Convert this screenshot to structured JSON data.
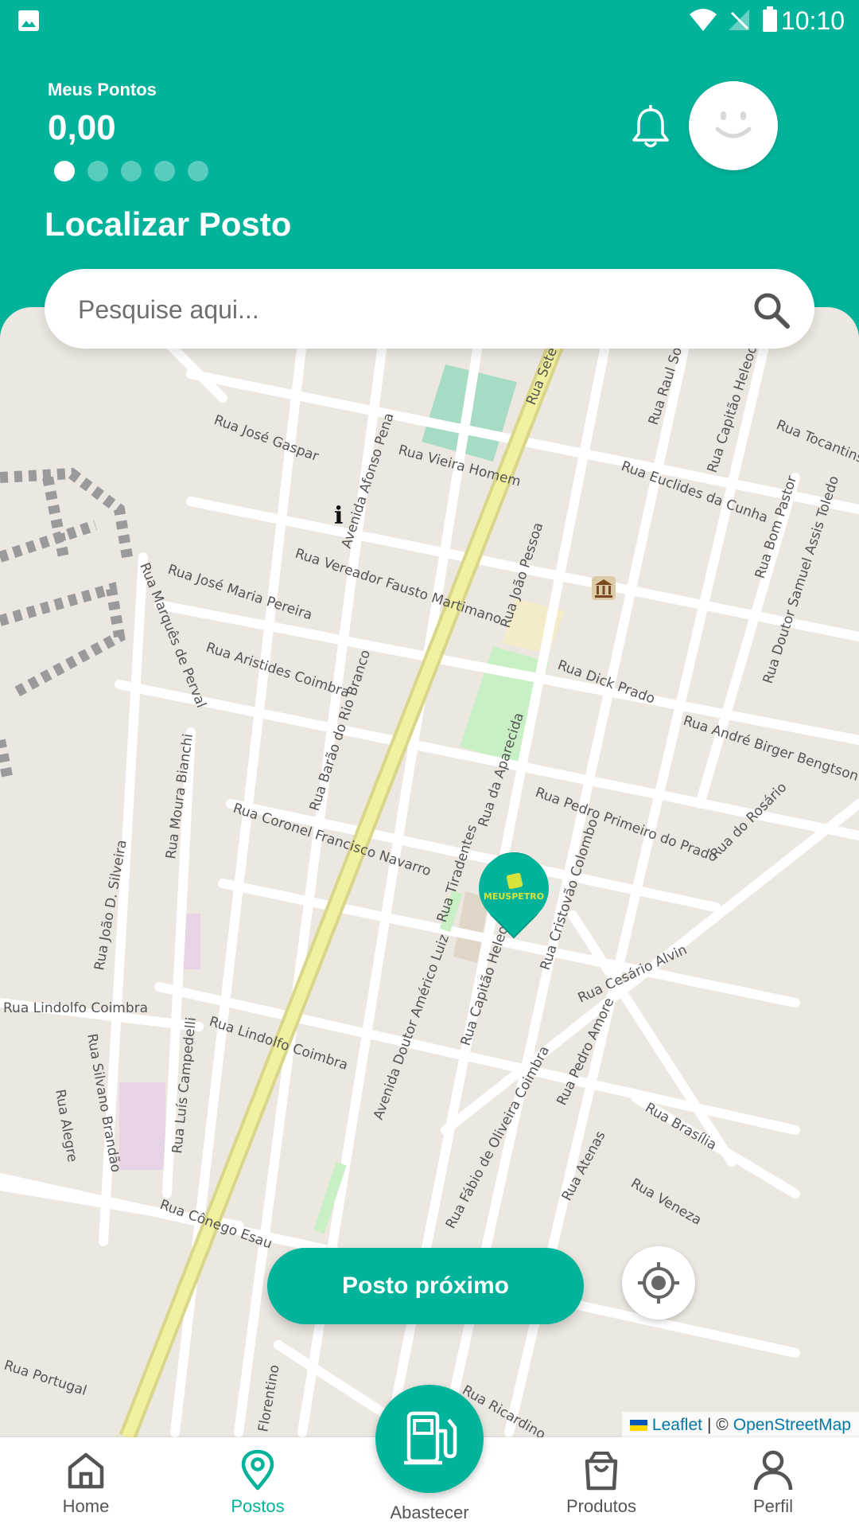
{
  "status_bar": {
    "time": "10:10"
  },
  "header": {
    "points_label": "Meus Pontos",
    "points_value": "0,00",
    "carousel_dots": 5,
    "title": "Localizar Posto"
  },
  "search": {
    "placeholder": "Pesquise aqui..."
  },
  "map": {
    "streets": [
      "Rua José Gaspar",
      "Rua Vieira Homem",
      "Avenida Afonso Pena",
      "Rua Sete de Setembro",
      "Rua Euclides da Cunha",
      "Rua Tocantins",
      "Rua Vereador Fausto Martimano",
      "Rua João Pessoa",
      "Rua José Maria Pereira",
      "Rua Dick Prado",
      "Rua Aristides Coimbra",
      "Rua Marquês de Perval",
      "Rua Barão do Rio Branco",
      "Rua André Birger Bengtson",
      "Rua da Aparecida",
      "Rua Pedro Primeiro do Prado",
      "Rua Coronel Francisco Navarro",
      "Rua Tiradentes",
      "Rua Moura Bianchi",
      "Rua João D. Silveira",
      "Rua Cristovão Colombo",
      "Rua do Rosário",
      "Rua Cesário Alvin",
      "Rua Lindolfo Coimbra",
      "Avenida Doutor Américo Luiz",
      "Rua Capitão Heleodoro",
      "Rua Alegre",
      "Rua Silvano Brandão",
      "Rua Luís Campedelli",
      "Rua Pedro Amore",
      "Rua Fábio de Oliveira Coimbra",
      "Rua Brasília",
      "Rua Atenas",
      "Rua Veneza",
      "Rua Cônego Esau",
      "Rua Portugal",
      "Rua Ricardino",
      "Rua Bom Pastor",
      "Rua Doutor Samuel Assis Toledo",
      "Rua Raul Soares",
      "Rua Capitão Heleodoro",
      "Florentino"
    ],
    "marker_brand": "MEUSPETRO"
  },
  "actions": {
    "nearest_label": "Posto próximo"
  },
  "attribution": {
    "leaflet": "Leaflet",
    "separator": "| ©",
    "osm": "OpenStreetMap"
  },
  "nav": {
    "home": "Home",
    "postos": "Postos",
    "abastecer": "Abastecer",
    "produtos": "Produtos",
    "perfil": "Perfil",
    "active": "postos"
  },
  "colors": {
    "primary": "#00B39A",
    "map_bg": "#ECE7E1",
    "major_road": "#F2F1A0"
  }
}
